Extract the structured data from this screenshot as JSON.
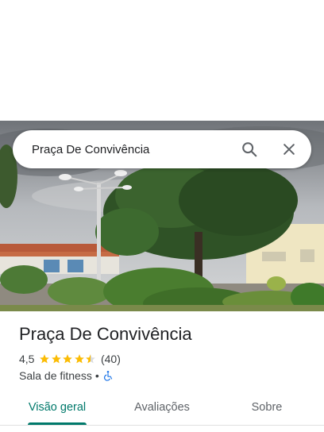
{
  "search": {
    "query": "Praça De Convivência"
  },
  "place": {
    "name": "Praça De Convivência",
    "rating": "4,5",
    "rating_value": 4.5,
    "review_count": "(40)",
    "category": "Sala de fitness",
    "separator": "•",
    "accessibility_icon": "wheelchair-icon"
  },
  "tabs": [
    {
      "label": "Visão geral",
      "active": true
    },
    {
      "label": "Avaliações",
      "active": false
    },
    {
      "label": "Sobre",
      "active": false
    }
  ],
  "colors": {
    "accent": "#00796b",
    "star": "#fbbc04",
    "accessibility": "#1a73e8",
    "text_primary": "#202124",
    "text_secondary": "#3c4043"
  }
}
